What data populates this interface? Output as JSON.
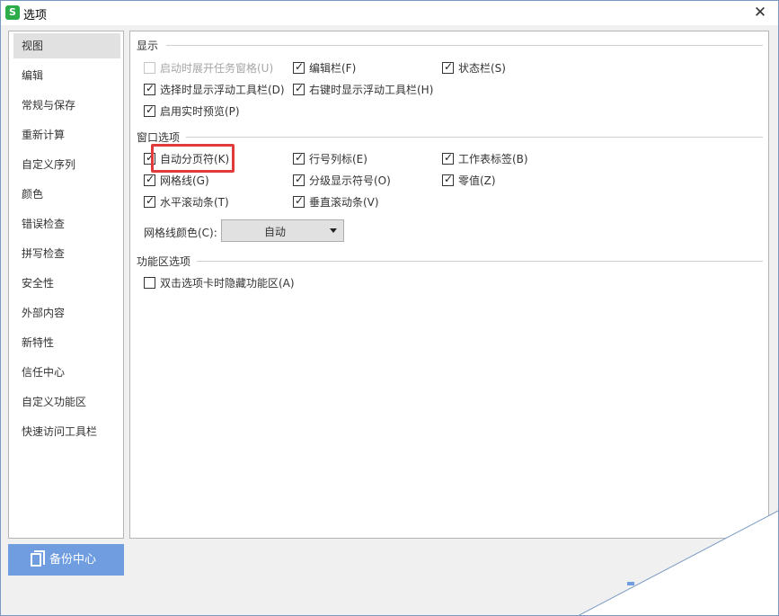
{
  "window": {
    "title": "选项",
    "app_icon_text": "S"
  },
  "sidebar": {
    "items": [
      {
        "label": "视图",
        "selected": true
      },
      {
        "label": "编辑"
      },
      {
        "label": "常规与保存"
      },
      {
        "label": "重新计算"
      },
      {
        "label": "自定义序列"
      },
      {
        "label": "颜色"
      },
      {
        "label": "错误检查"
      },
      {
        "label": "拼写检查"
      },
      {
        "label": "安全性"
      },
      {
        "label": "外部内容"
      },
      {
        "label": "新特性"
      },
      {
        "label": "信任中心"
      },
      {
        "label": "自定义功能区"
      },
      {
        "label": "快速访问工具栏"
      }
    ]
  },
  "backup": {
    "label": "备份中心"
  },
  "display": {
    "title": "显示",
    "options": [
      {
        "label": "启动时展开任务窗格(U)",
        "checked": false,
        "disabled": true
      },
      {
        "label": "编辑栏(F)",
        "checked": true
      },
      {
        "label": "状态栏(S)",
        "checked": true
      },
      {
        "label": "选择时显示浮动工具栏(D)",
        "checked": true
      },
      {
        "label": "右键时显示浮动工具栏(H)",
        "checked": true
      },
      {
        "label": "启用实时预览(P)",
        "checked": true
      }
    ]
  },
  "window_options": {
    "title": "窗口选项",
    "options": [
      {
        "label": "自动分页符(K)",
        "checked": true
      },
      {
        "label": "行号列标(E)",
        "checked": true
      },
      {
        "label": "工作表标签(B)",
        "checked": true
      },
      {
        "label": "网格线(G)",
        "checked": true
      },
      {
        "label": "分级显示符号(O)",
        "checked": true
      },
      {
        "label": "零值(Z)",
        "checked": true
      },
      {
        "label": "水平滚动条(T)",
        "checked": true
      },
      {
        "label": "垂直滚动条(V)",
        "checked": true
      }
    ],
    "grid_color_label": "网格线颜色(C):",
    "grid_color_value": "自动"
  },
  "ribbon_options": {
    "title": "功能区选项",
    "options": [
      {
        "label": "双击选项卡时隐藏功能区(A)",
        "checked": false
      }
    ]
  },
  "colors": {
    "accent": "#6f9de0",
    "highlight": "#e03a3a",
    "app_icon": "#2dac4a"
  }
}
